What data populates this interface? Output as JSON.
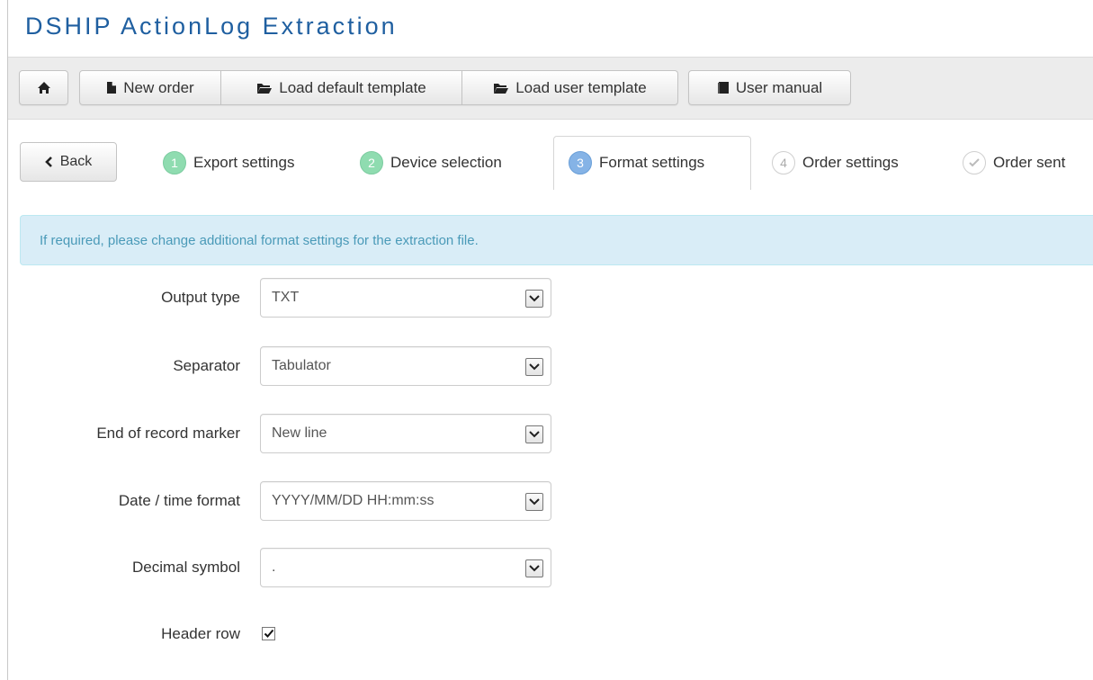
{
  "app": {
    "title": "DSHIP ActionLog Extraction"
  },
  "toolbar": {
    "new_order": "New order",
    "load_default_template": "Load default template",
    "load_user_template": "Load user template",
    "user_manual": "User manual"
  },
  "wizard": {
    "back_label": "Back",
    "steps": [
      {
        "number": "1",
        "label": "Export settings",
        "state": "done"
      },
      {
        "number": "2",
        "label": "Device selection",
        "state": "done"
      },
      {
        "number": "3",
        "label": "Format settings",
        "state": "active"
      },
      {
        "number": "4",
        "label": "Order settings",
        "state": "todo"
      },
      {
        "number": "",
        "label": "Order sent",
        "state": "todo"
      }
    ]
  },
  "info": {
    "message": "If required, please change additional format settings for the extraction file."
  },
  "form": {
    "output_type": {
      "label": "Output type",
      "value": "TXT"
    },
    "separator": {
      "label": "Separator",
      "value": "Tabulator"
    },
    "end_of_record_marker": {
      "label": "End of record marker",
      "value": "New line"
    },
    "date_time_format": {
      "label": "Date / time format",
      "value": "YYYY/MM/DD HH:mm:ss"
    },
    "decimal_symbol": {
      "label": "Decimal symbol",
      "value": "."
    },
    "header_row": {
      "label": "Header row",
      "checked": true
    }
  },
  "colors": {
    "title": "#1f5fa0",
    "info_bg": "#d9edf7",
    "info_text": "#4a9ab8",
    "step_done": "#8fdcb0",
    "step_active": "#85b3e6"
  },
  "icons": {
    "home": "home-icon",
    "new_order": "file-icon",
    "load_default_template": "folder-open-icon",
    "load_user_template": "folder-open-icon",
    "user_manual": "book-icon",
    "back": "chevron-left-icon",
    "order_sent": "check-circle-icon",
    "select_arrow": "chevron-down-icon",
    "checkbox": "checkmark-icon"
  }
}
